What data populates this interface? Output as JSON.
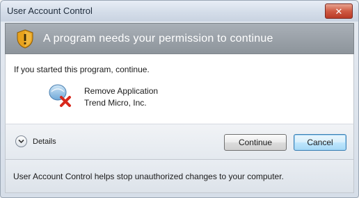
{
  "window": {
    "title": "User Account Control",
    "close_label": "✕"
  },
  "banner": {
    "text": "A program needs your permission to continue",
    "icon": "shield-warning-icon",
    "color": "#979ea5"
  },
  "content": {
    "instruction": "If you started this program, continue.",
    "app": {
      "name": "Remove Application",
      "publisher": "Trend Micro, Inc.",
      "icon": "remove-application-icon"
    }
  },
  "actions": {
    "details_label": "Details",
    "continue_label": "Continue",
    "cancel_label": "Cancel"
  },
  "footer": {
    "text": "User Account Control helps stop unauthorized changes to your computer."
  },
  "colors": {
    "close_button": "#cf5a43",
    "shield": "#e8a21c",
    "default_button": "#bee6fd"
  }
}
